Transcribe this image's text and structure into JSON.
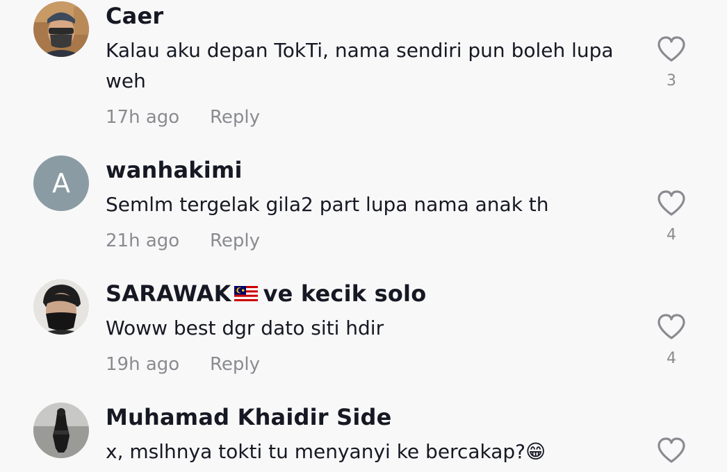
{
  "comments": [
    {
      "username": "Caer",
      "text": "Kalau aku depan TokTi, nama sendiri pun boleh lupa weh",
      "time": "17h ago",
      "reply_label": "Reply",
      "likes": "3",
      "avatar": "photo"
    },
    {
      "username": "wanhakimi",
      "text": "Semlm tergelak gila2 part lupa nama anak th",
      "time": "21h ago",
      "reply_label": "Reply",
      "likes": "4",
      "avatar_letter": "A"
    },
    {
      "username_before": "SARAWAK",
      "username_after": "ve kecik solo",
      "username_flag": "malaysia-flag",
      "text": "Woww best dgr dato siti hdir",
      "time": "19h ago",
      "reply_label": "Reply",
      "likes": "4",
      "avatar": "photo"
    },
    {
      "username": "Muhamad Khaidir Side",
      "text": "x, mslhnya tokti tu menyanyi ke bercakap?😁",
      "avatar": "photo"
    }
  ],
  "icons": {
    "like": "heart-outline-icon"
  },
  "colors": {
    "background": "#f8f8f8",
    "text_primary": "#161823",
    "text_secondary": "#8a8b91",
    "avatar_letter_bg": "#8a9ba3"
  }
}
